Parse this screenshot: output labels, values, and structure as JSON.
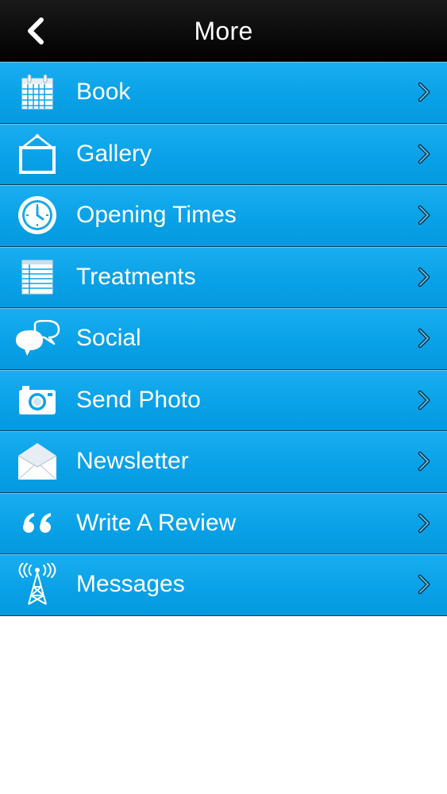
{
  "header": {
    "title": "More",
    "back_icon": "chevron-left-icon"
  },
  "menu": {
    "items": [
      {
        "label": "Book",
        "icon": "calendar-icon"
      },
      {
        "label": "Gallery",
        "icon": "picture-frame-icon"
      },
      {
        "label": "Opening Times",
        "icon": "clock-icon"
      },
      {
        "label": "Treatments",
        "icon": "list-icon"
      },
      {
        "label": "Social",
        "icon": "speech-bubbles-icon"
      },
      {
        "label": "Send Photo",
        "icon": "camera-icon"
      },
      {
        "label": "Newsletter",
        "icon": "envelope-icon"
      },
      {
        "label": "Write A Review",
        "icon": "quote-icon"
      },
      {
        "label": "Messages",
        "icon": "antenna-icon"
      }
    ],
    "chevron_icon": "chevron-right-icon"
  },
  "colors": {
    "nav_background": "#000000",
    "row_background": "#0aa3e8",
    "row_separator": "#0f3d55",
    "text": "#ffffff"
  }
}
